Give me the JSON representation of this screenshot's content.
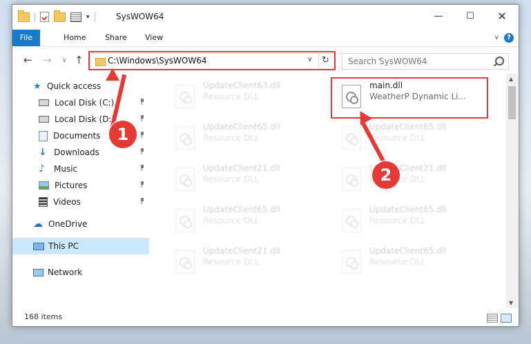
{
  "window": {
    "title": "SysWOW64"
  },
  "ribbon": {
    "tabs": [
      {
        "label": "File"
      },
      {
        "label": "Home"
      },
      {
        "label": "Share"
      },
      {
        "label": "View"
      }
    ],
    "help": "?"
  },
  "address": {
    "path": "C:\\Windows\\SysWOW64",
    "dropdown": "∨",
    "refresh": "↻"
  },
  "search": {
    "placeholder": "Search SysWOW64"
  },
  "sidebar": {
    "items": [
      {
        "label": "Quick access",
        "icon": "star-icon"
      },
      {
        "label": "Local Disk (C:)",
        "icon": "drive-icon"
      },
      {
        "label": "Local Disk (D:)",
        "icon": "drive-icon"
      },
      {
        "label": "Documents",
        "icon": "documents-icon"
      },
      {
        "label": "Downloads",
        "icon": "download-icon"
      },
      {
        "label": "Music",
        "icon": "music-icon"
      },
      {
        "label": "Pictures",
        "icon": "pictures-icon"
      },
      {
        "label": "Videos",
        "icon": "videos-icon"
      },
      {
        "label": "OneDrive",
        "icon": "cloud-icon"
      },
      {
        "label": "This PC",
        "icon": "monitor-icon"
      },
      {
        "label": "Network",
        "icon": "network-icon"
      }
    ]
  },
  "files": {
    "main": {
      "name": "main.dll",
      "desc": "WeatherP Dynamic Li..."
    },
    "faded": [
      {
        "name": "UpdateClient63.dll",
        "desc": "Resource DLL"
      },
      {
        "name": "UpdateClient65.dll",
        "desc": "Resource DLL"
      },
      {
        "name": "UpdateClient21.dll",
        "desc": "Resource DLL"
      },
      {
        "name": "UpdateClient65.dll",
        "desc": "Resource DLL"
      },
      {
        "name": "UpdateClient21.dll",
        "desc": "Resource DLL"
      },
      {
        "name": "UpdateClient65.dll",
        "desc": "Resource DLL"
      },
      {
        "name": "UpdateClient21.dll",
        "desc": "Resource DLL"
      },
      {
        "name": "UpdateClient65.dll",
        "desc": "Resource DLL"
      },
      {
        "name": "UpdateClient65.dll",
        "desc": "Resource DLL"
      }
    ]
  },
  "status": {
    "count": "168 items"
  },
  "annotations": {
    "step1": "1",
    "step2": "2",
    "color": "#e53935"
  }
}
